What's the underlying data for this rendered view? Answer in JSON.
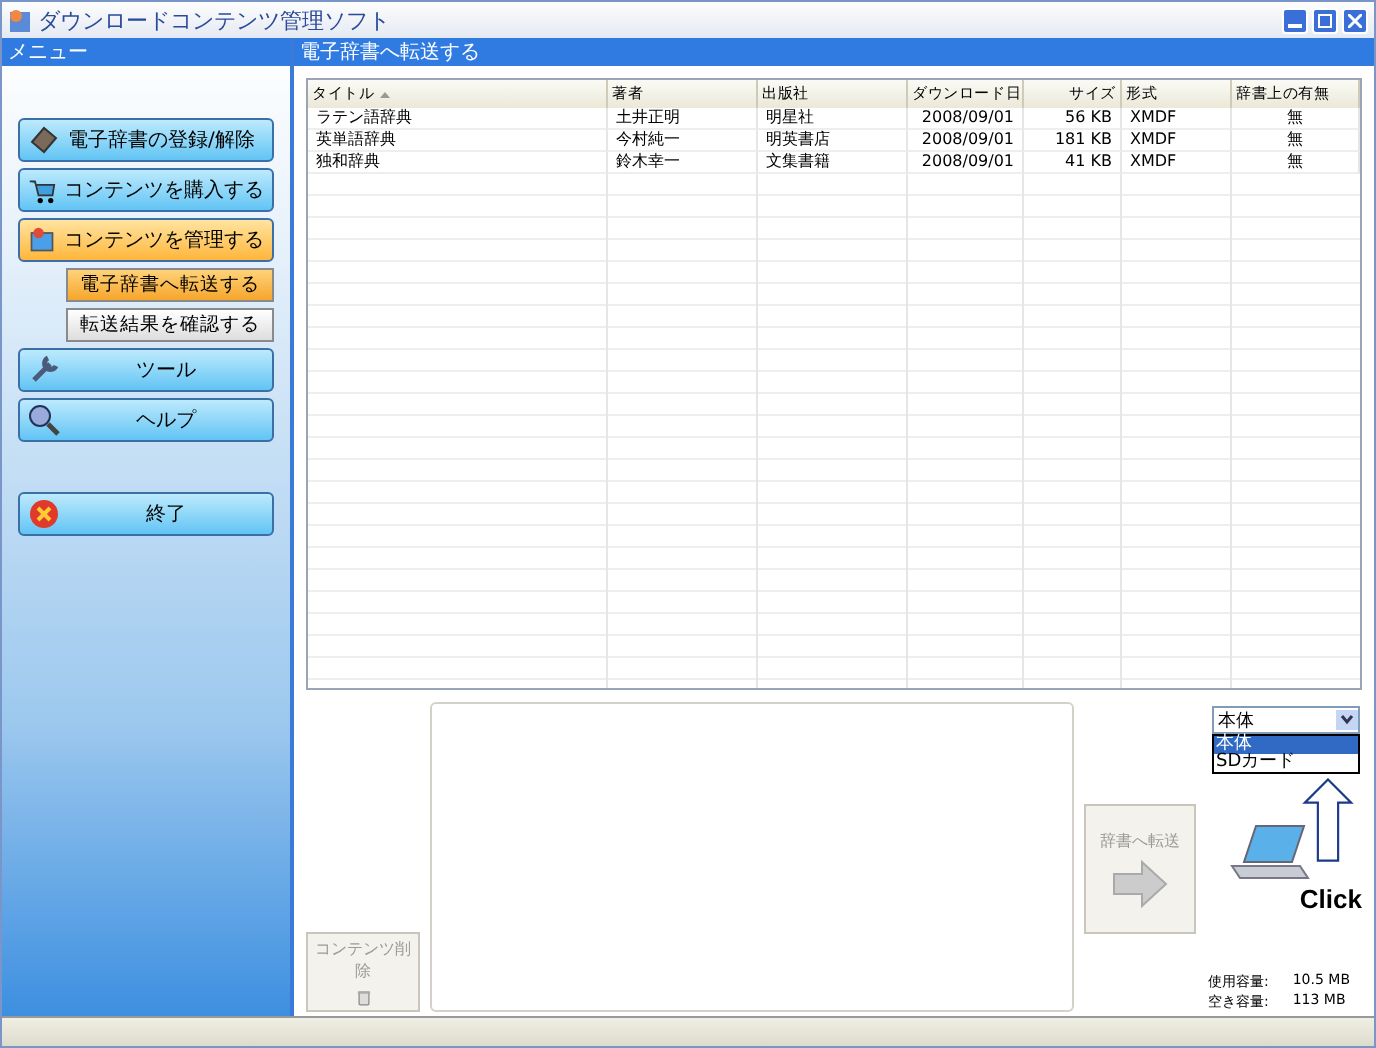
{
  "window": {
    "title": "ダウンロードコンテンツ管理ソフト"
  },
  "sidebar": {
    "title": "メニュー",
    "items": [
      {
        "label": "電子辞書の登録/解除",
        "kind": "main",
        "selected": false
      },
      {
        "label": "コンテンツを購入する",
        "kind": "main",
        "selected": false
      },
      {
        "label": "コンテンツを管理する",
        "kind": "main",
        "selected": true
      },
      {
        "label": "電子辞書へ転送する",
        "kind": "sub",
        "selected": true
      },
      {
        "label": "転送結果を確認する",
        "kind": "sub",
        "selected": false
      },
      {
        "label": "ツール",
        "kind": "main",
        "selected": false
      },
      {
        "label": "ヘルプ",
        "kind": "main",
        "selected": false
      },
      {
        "label": "終了",
        "kind": "exit",
        "selected": false
      }
    ]
  },
  "panel": {
    "title": "電子辞書へ転送する"
  },
  "table": {
    "columns": [
      "タイトル",
      "著者",
      "出版社",
      "ダウンロード日",
      "サイズ",
      "形式",
      "辞書上の有無"
    ],
    "rows": [
      [
        "ラテン語辞典",
        "土井正明",
        "明星社",
        "2008/09/01",
        "56 KB",
        "XMDF",
        "無"
      ],
      [
        "英単語辞典",
        "今村純一",
        "明英書店",
        "2008/09/01",
        "181 KB",
        "XMDF",
        "無"
      ],
      [
        "独和辞典",
        "鈴木幸一",
        "文集書籍",
        "2008/09/01",
        "41 KB",
        "XMDF",
        "無"
      ]
    ]
  },
  "delete_button": {
    "label": "コンテンツ削除",
    "disabled": true
  },
  "transfer_button": {
    "label": "辞書へ転送",
    "disabled": true
  },
  "device_select": {
    "value": "本体",
    "options": [
      {
        "label": "本体",
        "selected": true
      },
      {
        "label": "SDカード",
        "selected": false
      }
    ]
  },
  "callout": {
    "label": "Click"
  },
  "storage": [
    {
      "label": "使用容量:",
      "value": "10.5 MB"
    },
    {
      "label": "空き容量:",
      "value": "113 MB"
    }
  ]
}
